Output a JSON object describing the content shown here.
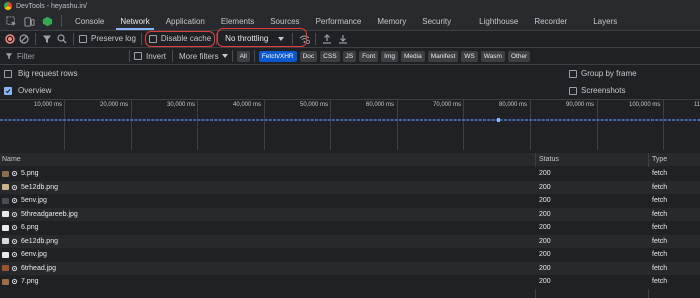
{
  "window": {
    "title": "DevTools - heyashu.in/"
  },
  "tabs": [
    "Console",
    "Network",
    "Application",
    "Elements",
    "Sources",
    "Performance",
    "Memory",
    "Security",
    "Lighthouse",
    "Recorder",
    "Layers"
  ],
  "active_tab": "Network",
  "toolbar": {
    "preserve_log": "Preserve log",
    "disable_cache": "Disable cache",
    "throttling": "No throttling"
  },
  "filter": {
    "placeholder": "Filter",
    "invert": "Invert",
    "more_filters": "More filters",
    "types": [
      "All",
      "Fetch/XHR",
      "Doc",
      "CSS",
      "JS",
      "Font",
      "Img",
      "Media",
      "Manifest",
      "WS",
      "Wasm",
      "Other"
    ],
    "selected_type": "Fetch/XHR"
  },
  "options": {
    "big_request_rows": "Big request rows",
    "group_by_frame": "Group by frame",
    "overview": "Overview",
    "screenshots": "Screenshots"
  },
  "timeline": {
    "ticks": [
      "10,000 ms",
      "20,000 ms",
      "30,000 ms",
      "40,000 ms",
      "50,000 ms",
      "60,000 ms",
      "70,000 ms",
      "80,000 ms",
      "90,000 ms",
      "100,000 ms",
      "11"
    ]
  },
  "table": {
    "columns": {
      "name": "Name",
      "status": "Status",
      "type": "Type"
    },
    "rows": [
      {
        "name": "5.png",
        "status": "200",
        "type": "fetch",
        "color": "#8a6d4a"
      },
      {
        "name": "5e12db.png",
        "status": "200",
        "type": "fetch",
        "color": "#c9b48a"
      },
      {
        "name": "5env.jpg",
        "status": "200",
        "type": "fetch",
        "color": "#4a4d52"
      },
      {
        "name": "5threadgareeb.jpg",
        "status": "200",
        "type": "fetch",
        "color": "#e8eaed"
      },
      {
        "name": "6.png",
        "status": "200",
        "type": "fetch",
        "color": "#e8eaed"
      },
      {
        "name": "6e12db.png",
        "status": "200",
        "type": "fetch",
        "color": "#d9d9d9"
      },
      {
        "name": "6env.jpg",
        "status": "200",
        "type": "fetch",
        "color": "#e8eaed"
      },
      {
        "name": "6trhead.jpg",
        "status": "200",
        "type": "fetch",
        "color": "#a0522d"
      },
      {
        "name": "7.png",
        "status": "200",
        "type": "fetch",
        "color": "#9c6b4a"
      }
    ]
  },
  "colors": {
    "accent": "#8ab4f8",
    "annotation": "#e03d3d",
    "record": "#f28b82"
  }
}
